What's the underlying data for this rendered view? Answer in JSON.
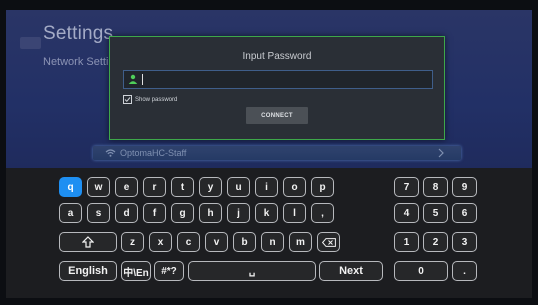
{
  "settings": {
    "title": "Settings",
    "subtitle": "Network Settings"
  },
  "dialog": {
    "title": "Input Password",
    "password_value": "",
    "show_password_label": "Show password",
    "show_password_checked": true,
    "connect_label": "CONNECT",
    "border_color": "#3ea84a"
  },
  "network": {
    "selected_ssid": "OptomaHC-Staff"
  },
  "keyboard": {
    "accent_color": "#1e8ff2",
    "focused_key": "q",
    "row1": [
      "q",
      "w",
      "e",
      "r",
      "t",
      "y",
      "u",
      "i",
      "o",
      "p"
    ],
    "row2": [
      "a",
      "s",
      "d",
      "f",
      "g",
      "h",
      "j",
      "k",
      "l",
      ","
    ],
    "row3": [
      "z",
      "x",
      "c",
      "v",
      "b",
      "n",
      "m"
    ],
    "numpad": [
      [
        "7",
        "8",
        "9"
      ],
      [
        "4",
        "5",
        "6"
      ],
      [
        "1",
        "2",
        "3"
      ]
    ],
    "language_label": "English",
    "input_mode_label": "中\\En",
    "symbols_label": "#*?",
    "space_label": "␣",
    "next_label": "Next",
    "zero_label": "0",
    "dot_label": ".",
    "shift_icon": "shift-up-icon",
    "backspace_icon": "backspace-icon"
  }
}
